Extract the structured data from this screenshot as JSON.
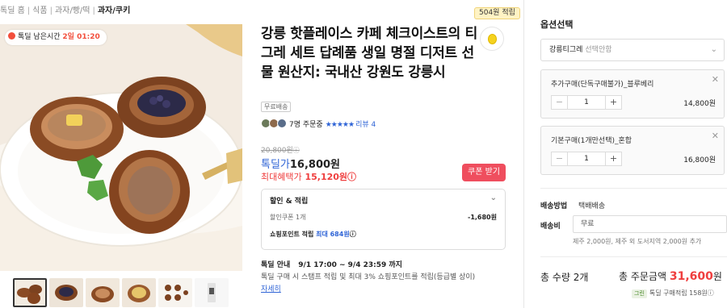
{
  "breadcrumb": [
    "톡딜 홈",
    "식품",
    "과자/빵/떡",
    "과자/쿠키"
  ],
  "point_badge": "504원 적립",
  "timer": {
    "label": "톡딜 남은시간",
    "value": "2일 01:20"
  },
  "product": {
    "title": "강릉 핫플레이스 카페 체크이스트의 티그레 세트 답례품 생일 명절 디저트 선물 원산지: 국내산 강원도 강릉시",
    "free_shipping": "무료배송",
    "buyers": "7명 주문중",
    "stars": "★★★★★",
    "review_link": "리뷰 4",
    "original_price": "20,800원",
    "original_price_icon": "ⓘ",
    "sale_label": "톡딜가",
    "sale_price": "16,800원",
    "max_label": "최대혜택가",
    "max_price": "15,120원",
    "max_icon": "ⓘ",
    "coupon_button": "쿠폰 받기"
  },
  "benefits": {
    "title": "할인 & 적립",
    "coupon_label": "할인쿠폰 1개",
    "coupon_amount": "-1,680원",
    "point_label": "쇼핑포인트 적립",
    "point_value": "최대 684원",
    "point_icon": "ⓘ"
  },
  "notice": {
    "title": "톡딜 안내",
    "period": "9/1 17:00 ~ 9/4 23:59 까지",
    "text": "톡딜 구매 시 스탬프 적립 및 최대 3% 쇼핑포인트를 적립(등급별 상이)",
    "link": "자세히"
  },
  "options": {
    "title": "옵션선택",
    "select_value": "강릉티그레",
    "select_placeholder": "선택안함",
    "items": [
      {
        "name": "추가구매(단독구매불가)_블루베리",
        "qty": "1",
        "price": "14,800원"
      },
      {
        "name": "기본구매(1개만선택)_혼합",
        "qty": "1",
        "price": "16,800원"
      }
    ]
  },
  "shipping": {
    "method_label": "배송방법",
    "method_value": "택배배송",
    "fee_label": "배송비",
    "fee_value": "무료",
    "note": "제주 2,000원, 제주 외 도서지역 2,000원 추가"
  },
  "total": {
    "qty_label": "총 수량 2개",
    "price_label": "총 주문금액",
    "price_value": "31,600",
    "price_unit": "원",
    "sub_badge": "그린",
    "sub_text": "톡딜 구매적립 158원ⓘ"
  },
  "icons": {
    "close": "✕",
    "chevron": "⌄",
    "minus": "−",
    "plus": "+"
  },
  "colors": {
    "accent_blue": "#2f64d6",
    "accent_red": "#ef3e3e",
    "coupon_button": "#ef4e5e"
  }
}
